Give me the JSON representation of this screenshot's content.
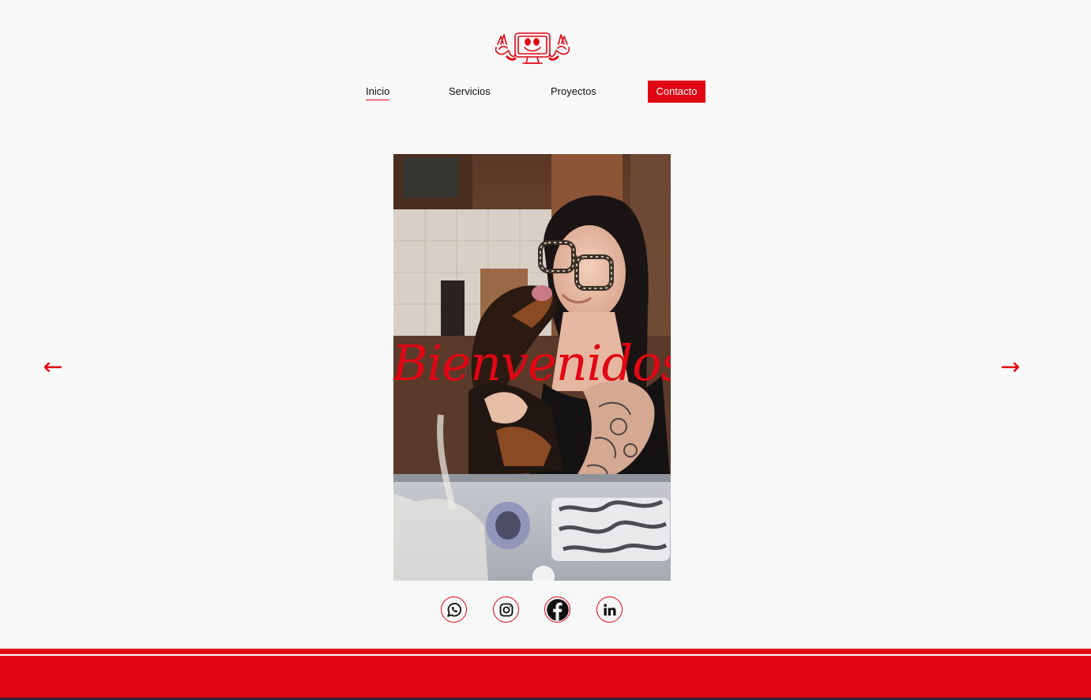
{
  "brand": {
    "logo_icon": "monitor-mascot-logo-icon",
    "accent_color": "#e10613"
  },
  "nav": {
    "items": [
      {
        "label": "Inicio",
        "active": true
      },
      {
        "label": "Servicios",
        "active": false
      },
      {
        "label": "Proyectos",
        "active": false
      },
      {
        "label": "Contacto",
        "highlighted": true
      }
    ]
  },
  "hero": {
    "title": "Bienvenidos!"
  },
  "carousel": {
    "prev_icon": "arrow-left-icon",
    "next_icon": "arrow-right-icon",
    "prev_glyph": "←",
    "next_glyph": "→"
  },
  "social": [
    {
      "name": "WhatsApp",
      "icon": "whatsapp-icon"
    },
    {
      "name": "Instagram",
      "icon": "instagram-icon"
    },
    {
      "name": "Facebook",
      "icon": "facebook-icon"
    },
    {
      "name": "LinkedIn",
      "icon": "linkedin-icon"
    }
  ]
}
